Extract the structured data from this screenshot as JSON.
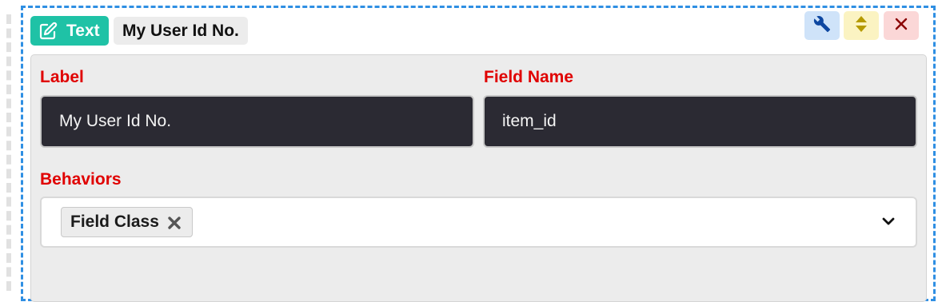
{
  "block": {
    "type_label": "Text",
    "name": "My User Id No.",
    "icons": {
      "type": "edit-square-icon",
      "settings": "wrench-icon",
      "move": "sort-arrows-icon",
      "remove": "close-icon"
    }
  },
  "form": {
    "label": {
      "title": "Label",
      "value": "My User Id No."
    },
    "field_name": {
      "title": "Field Name",
      "value": "item_id"
    },
    "behaviors": {
      "title": "Behaviors",
      "tags": [
        "Field Class"
      ],
      "chevron": "chevron-down-icon"
    }
  },
  "colors": {
    "type_badge": "#1fc2a6",
    "dashed_border": "#2f8fe3",
    "required_label": "#e00000",
    "input_bg": "#2b2a33"
  }
}
